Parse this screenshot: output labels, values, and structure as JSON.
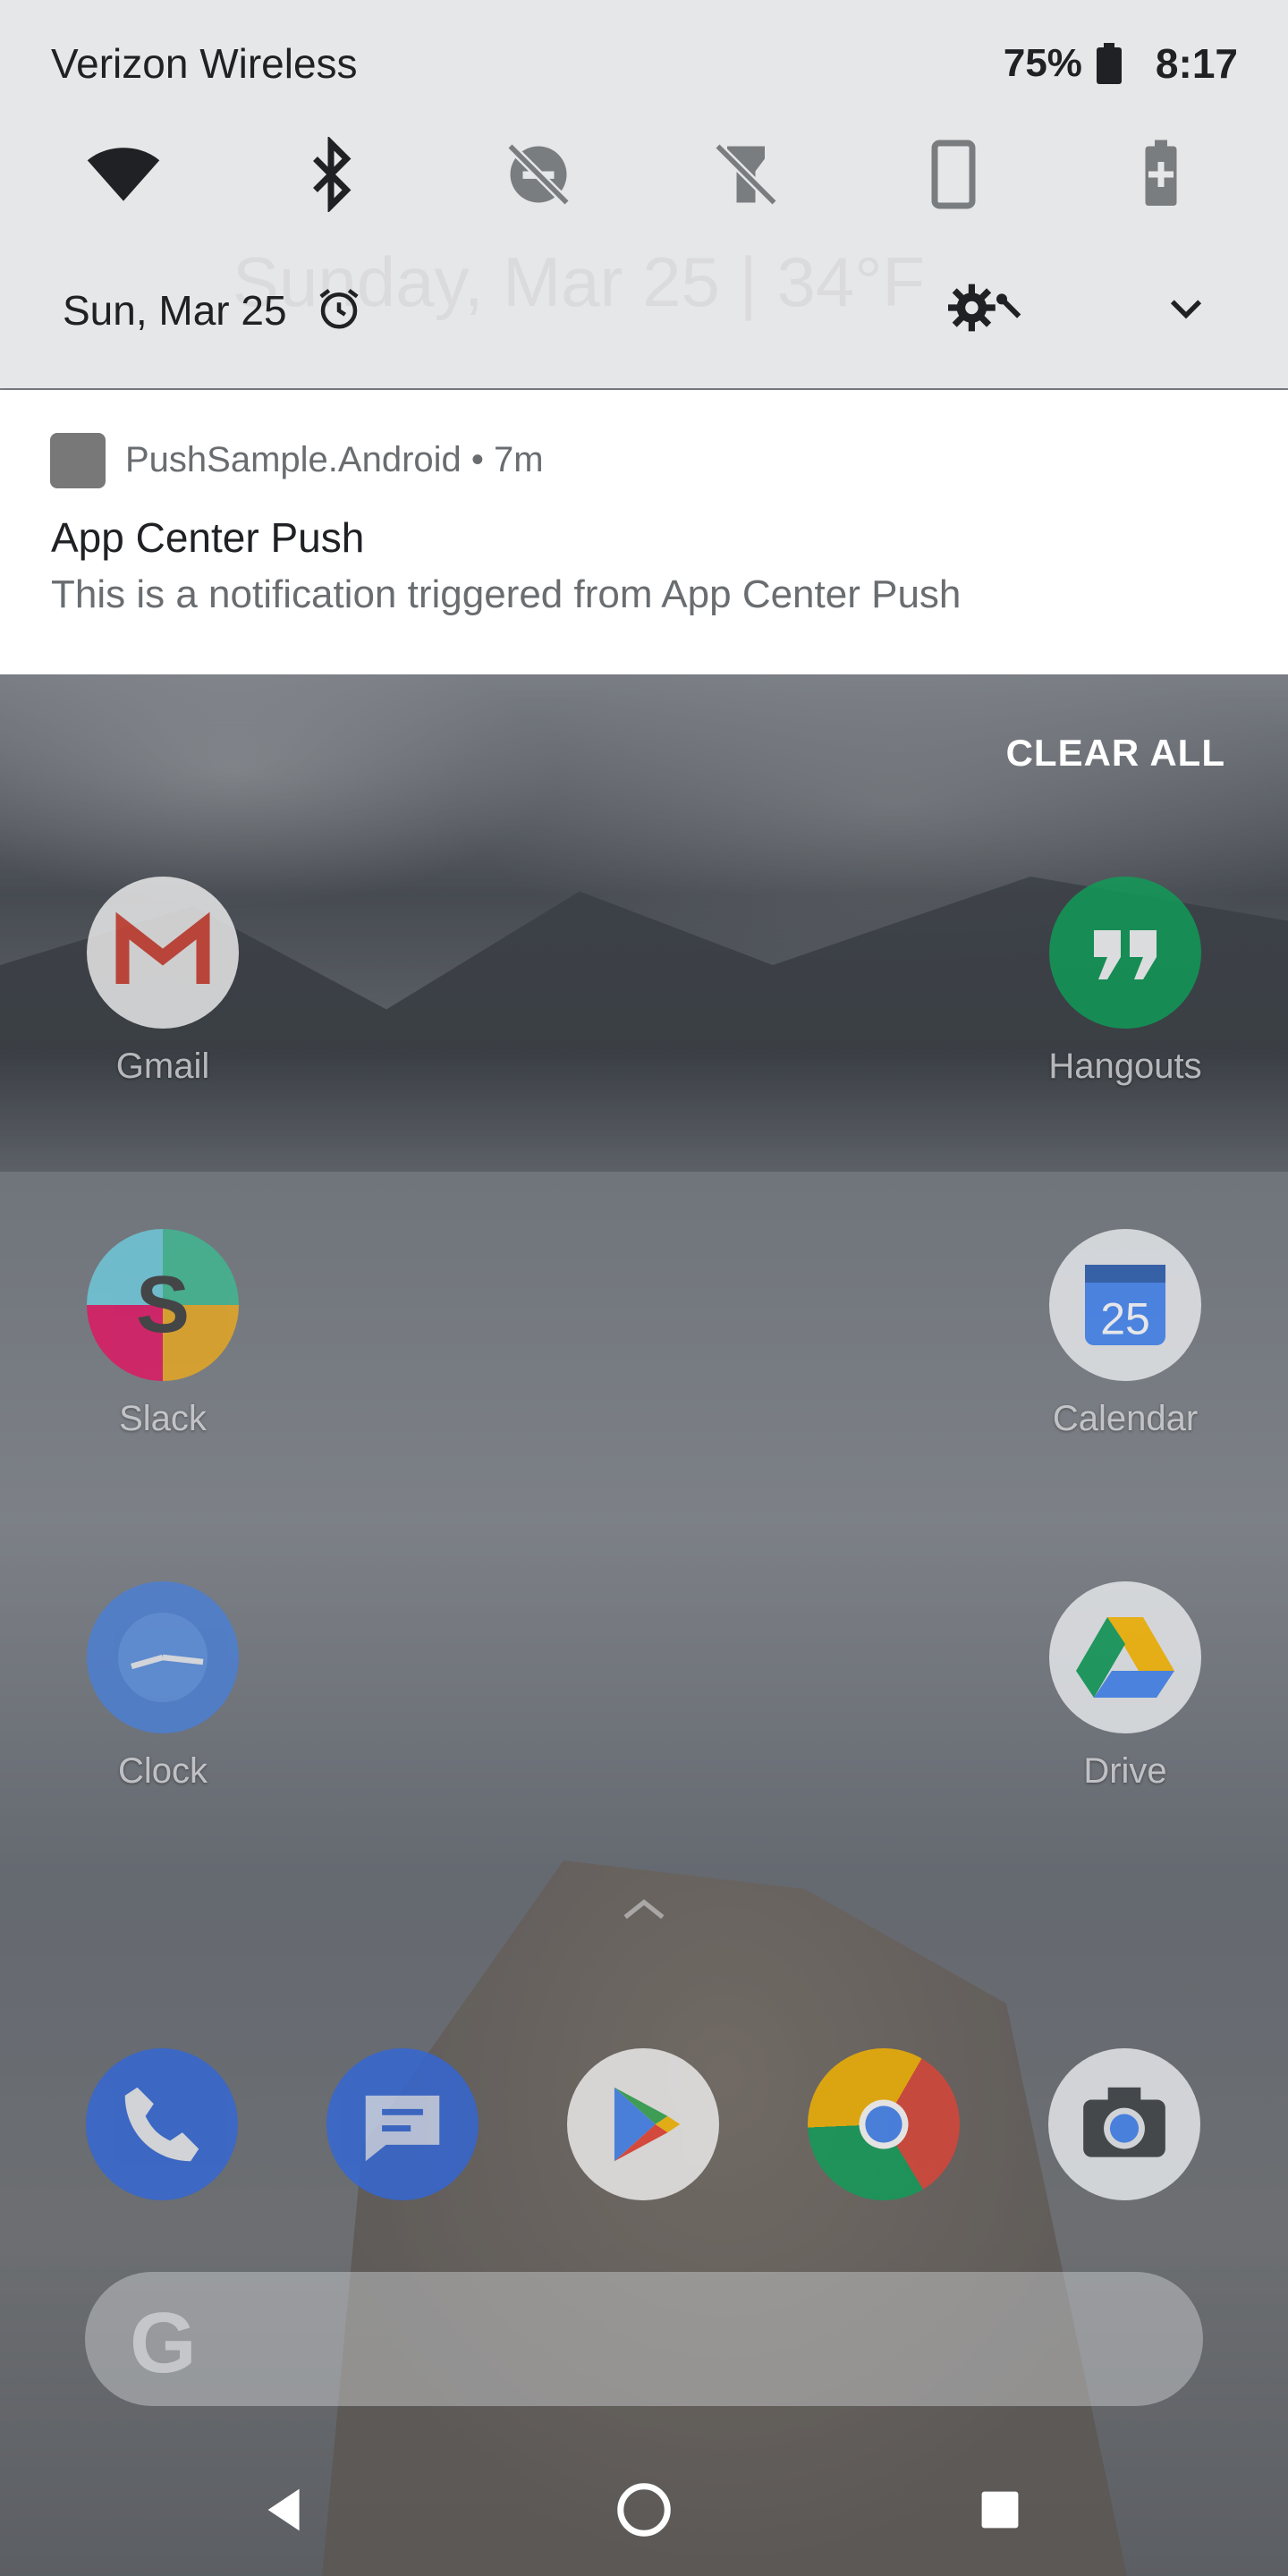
{
  "status_bar": {
    "carrier": "Verizon Wireless",
    "battery_percent": "75%",
    "time": "8:17"
  },
  "quick_settings": {
    "tiles": [
      "wifi-icon",
      "bluetooth-icon",
      "do-not-disturb-off-icon",
      "flashlight-off-icon",
      "auto-rotate-icon",
      "battery-saver-icon"
    ],
    "date": "Sun, Mar 25",
    "ghost_text": "Sunday, Mar 25  |  34°F"
  },
  "notification": {
    "app_name": "PushSample.Android",
    "age": "7m",
    "header": "PushSample.Android • 7m",
    "title": "App Center Push",
    "body": "This is a notification triggered from App Center Push"
  },
  "clear_all_label": "CLEAR ALL",
  "home_apps": {
    "gmail": "Gmail",
    "hangouts": "Hangouts",
    "slack": "Slack",
    "calendar": "Calendar",
    "calendar_day": "25",
    "clock": "Clock",
    "drive": "Drive"
  },
  "dock": [
    "phone-icon",
    "messages-icon",
    "play-store-icon",
    "chrome-icon",
    "camera-icon"
  ],
  "search": {
    "logo": "G"
  },
  "colors": {
    "panel_bg": "#e6e7e9",
    "notification_bg": "#ffffff",
    "text_primary": "#202124",
    "text_secondary": "#6a6d70"
  }
}
